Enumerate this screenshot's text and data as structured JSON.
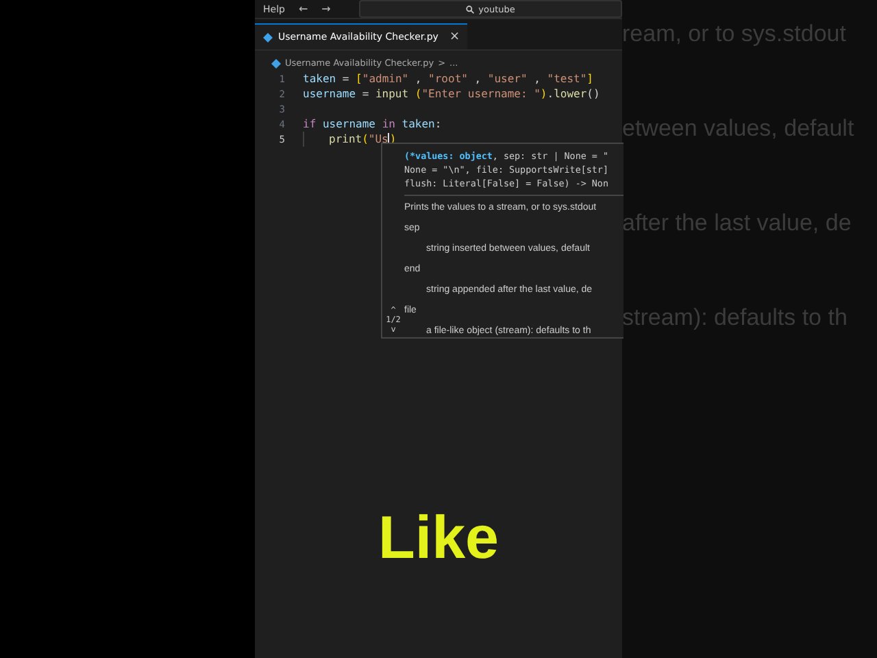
{
  "menu": {
    "label": "Help",
    "back": "←",
    "forward": "→",
    "search": "youtube"
  },
  "tab": {
    "label": "Username Availability Checker.py",
    "selected": true,
    "close": "×"
  },
  "breadcrumb": {
    "file": "Username Availability Checker.py",
    "separator": ">",
    "rest": "..."
  },
  "code": [
    {
      "number": "1",
      "active": false,
      "tokens": [
        {
          "kind": "var",
          "text": "taken"
        },
        {
          "kind": "plain",
          "text": " = "
        },
        {
          "kind": "bracket",
          "text": "["
        },
        {
          "kind": "string",
          "text": "\"admin\""
        },
        {
          "kind": "plain",
          "text": " , "
        },
        {
          "kind": "string",
          "text": "\"root\""
        },
        {
          "kind": "plain",
          "text": " , "
        },
        {
          "kind": "string",
          "text": "\"user\""
        },
        {
          "kind": "plain",
          "text": " , "
        },
        {
          "kind": "string",
          "text": "\"test\""
        },
        {
          "kind": "bracket",
          "text": "]"
        }
      ]
    },
    {
      "number": "2",
      "active": false,
      "tokens": [
        {
          "kind": "var",
          "text": "username"
        },
        {
          "kind": "plain",
          "text": " = "
        },
        {
          "kind": "func",
          "text": "input"
        },
        {
          "kind": "bracket",
          "text": " ("
        },
        {
          "kind": "string",
          "text": "\"Enter username: \""
        },
        {
          "kind": "bracket",
          "text": ")"
        },
        {
          "kind": "plain",
          "text": "."
        },
        {
          "kind": "func",
          "text": "lower"
        },
        {
          "kind": "plain",
          "text": "()"
        }
      ]
    },
    {
      "number": "3",
      "active": false
    },
    {
      "number": "4",
      "active": false,
      "tokens": [
        {
          "kind": "keyword",
          "text": "if "
        },
        {
          "kind": "var",
          "text": "username "
        },
        {
          "kind": "keyword",
          "text": "in "
        },
        {
          "kind": "var",
          "text": "taken"
        },
        {
          "kind": "plain",
          "text": ":"
        }
      ]
    },
    {
      "number": "5",
      "active": true,
      "indent": true,
      "tokens": [
        {
          "kind": "func",
          "text": "print"
        },
        {
          "kind": "bracket",
          "text": "("
        },
        {
          "kind": "string",
          "text": "\"Us",
          "cursor": true
        },
        {
          "kind": "bracket",
          "text": ")"
        }
      ]
    }
  ],
  "hover": {
    "counter": "1/2",
    "up": "^",
    "down": "v",
    "signature": [
      "(*values: object, sep: str | None = \"",
      "None = \"\\n\", file: SupportsWrite[str]",
      "flush: Literal[False] = False) -> Non"
    ],
    "summary": "Prints the values to a stream, or to sys.stdout",
    "params": [
      {
        "name": "sep",
        "text": "string inserted between values, default"
      },
      {
        "name": "end",
        "text": "string appended after the last value, de"
      },
      {
        "name": "file",
        "text": "a file-like object (stream): defaults to th"
      }
    ]
  },
  "caption": "Like",
  "backdrop": [
    "ream, or to sys.stdout",
    "etween values, default",
    "after the last value, de",
    "stream): defaults to th"
  ]
}
